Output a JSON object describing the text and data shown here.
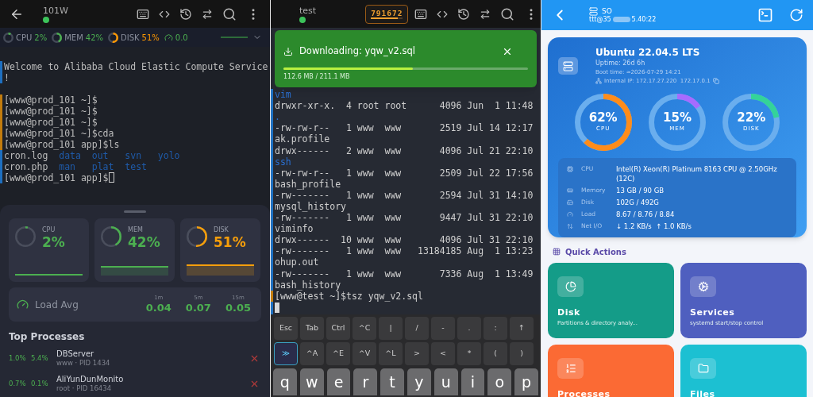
{
  "left": {
    "header": {
      "title": "101W",
      "online": true
    },
    "status_strip": [
      {
        "label": "CPU",
        "value": "2%",
        "level": 0.02,
        "color": "#4caf50"
      },
      {
        "label": "MEM",
        "value": "42%",
        "level": 0.42,
        "color": "#4caf50"
      },
      {
        "label": "DISK",
        "value": "51%",
        "level": 0.51,
        "color": "#ff9800"
      }
    ],
    "status_load": "0.0",
    "terminal": [
      {
        "kind": "text",
        "text": "Welcome to Alibaba Cloud Elastic Compute Service",
        "color": "#1e6fc0"
      },
      {
        "kind": "text",
        "text": "!",
        "color": "#1e6fc0"
      },
      {
        "kind": "blank"
      },
      {
        "kind": "text",
        "text": "[www@prod_101 ~]$",
        "color": "#c27c0e"
      },
      {
        "kind": "text",
        "text": "[www@prod_101 ~]$",
        "color": "#c27c0e"
      },
      {
        "kind": "text",
        "text": "[www@prod_101 ~]$",
        "color": "#c27c0e"
      },
      {
        "kind": "text",
        "text": "[www@prod_101 ~]$cda",
        "color": "#c27c0e"
      },
      {
        "kind": "text",
        "text": "[www@prod_101 app]$ls",
        "color": "#c27c0e"
      },
      {
        "kind": "files",
        "color": "#1e6fc0",
        "items": [
          {
            "text": "cron.log",
            "dir": false
          },
          {
            "text": "data",
            "dir": true
          },
          {
            "text": "out",
            "dir": true
          },
          {
            "text": "svn",
            "dir": true
          },
          {
            "text": "yolo",
            "dir": true
          }
        ]
      },
      {
        "kind": "files",
        "color": "#1e6fc0",
        "items": [
          {
            "text": "cron.php",
            "dir": false
          },
          {
            "text": "man",
            "dir": true
          },
          {
            "text": "plat",
            "dir": true
          },
          {
            "text": "test",
            "dir": true
          }
        ]
      },
      {
        "kind": "text",
        "text": "[www@prod_101 app]$",
        "color": "#1e6fc0",
        "cursor": true
      }
    ],
    "stats": [
      {
        "label": "CPU",
        "value": "2%",
        "level": 0.02,
        "color": "#4caf50"
      },
      {
        "label": "MEM",
        "value": "42%",
        "level": 0.42,
        "color": "#4caf50"
      },
      {
        "label": "DISK",
        "value": "51%",
        "level": 0.51,
        "color": "#f59e0b"
      }
    ],
    "load": {
      "label": "Load Avg",
      "values": [
        {
          "period": "1m",
          "value": "0.04"
        },
        {
          "period": "5m",
          "value": "0.07"
        },
        {
          "period": "15m",
          "value": "0.05"
        }
      ]
    },
    "processes_title": "Top Processes",
    "processes": [
      {
        "cpu": "1.0%",
        "mem": "5.4%",
        "name": "DBServer",
        "detail": "www · PID 1434"
      },
      {
        "cpu": "0.7%",
        "mem": "0.1%",
        "name": "AliYunDunMonito",
        "detail": "root · PID 16434"
      }
    ]
  },
  "middle": {
    "header": {
      "title": "test",
      "online": true
    },
    "badge": {
      "text": "791672",
      "level": 0.85
    },
    "download": {
      "title": "Downloading: yqw_v2.sql",
      "progress": "112.6 MB / 211.1 MB",
      "level": 0.53
    },
    "terminal": [
      {
        "text": "vim",
        "dir": true,
        "color": "#1e6fc0"
      },
      {
        "text": "drwxr-xr-x.  4 root root      4096 Jun  1 11:48",
        "dir": false,
        "color": "#1e6fc0"
      },
      {
        "text": ".",
        "dir": true,
        "color": "#1e6fc0"
      },
      {
        "text": "-rw-rw-r--   1 www  www       2519 Jul 14 12:17",
        "dir": false,
        "color": "#1e6fc0"
      },
      {
        "text": "ak.profile",
        "dir": false,
        "color": "#1e6fc0"
      },
      {
        "text": "drwx------   2 www  www       4096 Jul 21 22:10",
        "dir": false,
        "color": "#1e6fc0"
      },
      {
        "text": "ssh",
        "dir": true,
        "color": "#1e6fc0"
      },
      {
        "text": "-rw-rw-r--   1 www  www       2509 Jul 22 17:56",
        "dir": false,
        "color": "#1e6fc0"
      },
      {
        "text": "bash_profile",
        "dir": false,
        "color": "#1e6fc0"
      },
      {
        "text": "-rw-------   1 www  www       2594 Jul 31 14:10",
        "dir": false,
        "color": "#1e6fc0"
      },
      {
        "text": "mysql_history",
        "dir": false,
        "color": "#1e6fc0"
      },
      {
        "text": "-rw-------   1 www  www       9447 Jul 31 22:10",
        "dir": false,
        "color": "#1e6fc0"
      },
      {
        "text": "viminfo",
        "dir": false,
        "color": "#1e6fc0"
      },
      {
        "text": "drwx------  10 www  www       4096 Jul 31 22:10",
        "dir": false,
        "color": "#1e6fc0"
      },
      {
        "text": "-rw-------   1 www  www   13184185 Aug  1 13:23",
        "dir": false,
        "color": "#1e6fc0"
      },
      {
        "text": "ohup.out",
        "dir": false,
        "color": "#1e6fc0"
      },
      {
        "text": "-rw-------   1 www  www       7336 Aug  1 13:49",
        "dir": false,
        "color": "#1e6fc0"
      },
      {
        "text": "bash_history",
        "dir": false,
        "color": "#1e6fc0"
      },
      {
        "text": "[www@test ~]$tsz yqw_v2.sql",
        "dir": false,
        "color": "#c27c0e"
      }
    ],
    "extra_keys": [
      [
        {
          "label": "Esc",
          "active": false
        },
        {
          "label": "Tab",
          "active": false
        },
        {
          "label": "Ctrl",
          "active": false
        },
        {
          "label": "^C",
          "active": false
        },
        {
          "label": "|",
          "active": false
        },
        {
          "label": "/",
          "active": false
        },
        {
          "label": "-",
          "active": false
        },
        {
          "label": ".",
          "active": false
        },
        {
          "label": ":",
          "active": false
        },
        {
          "label": "↑",
          "active": false
        }
      ],
      [
        {
          "label": "≫",
          "active": true
        },
        {
          "label": "^A",
          "active": false
        },
        {
          "label": "^E",
          "active": false
        },
        {
          "label": "^V",
          "active": false
        },
        {
          "label": "^L",
          "active": false
        },
        {
          "label": ">",
          "active": false
        },
        {
          "label": "<",
          "active": false
        },
        {
          "label": "*",
          "active": false
        },
        {
          "label": "(",
          "active": false
        },
        {
          "label": ")",
          "active": false
        }
      ]
    ],
    "keyboard": [
      "q",
      "w",
      "e",
      "r",
      "t",
      "y",
      "u",
      "i",
      "o",
      "p"
    ]
  },
  "right": {
    "header": {
      "title": "SO",
      "host_start": "ttt@35",
      "host_end": "5.40:22"
    },
    "system": {
      "os": "Ubuntu 22.04.5 LTS",
      "uptime": "Uptime: 26d 6h",
      "boot": "Boot time: ≈2026-07-29 14:21",
      "ip": "Internal IP: 172.17.27.220  172.17.0.1"
    },
    "rings": [
      {
        "value": "62%",
        "label": "CPU",
        "level": 0.62,
        "color": "#ff8c1a"
      },
      {
        "value": "15%",
        "label": "MEM",
        "level": 0.15,
        "color": "#a66bff"
      },
      {
        "value": "22%",
        "label": "DISK",
        "level": 0.22,
        "color": "#34d399"
      }
    ],
    "details": [
      {
        "kind": "cpu",
        "label": "CPU",
        "value": "Intel(R) Xeon(R) Platinum 8163 CPU @ 2.50GHz (12C)"
      },
      {
        "kind": "memory",
        "label": "Memory",
        "value": "13 GB / 90 GB"
      },
      {
        "kind": "disk",
        "label": "Disk",
        "value": "102G / 492G"
      },
      {
        "kind": "load",
        "label": "Load",
        "value": "8.67 / 8.76 / 8.84"
      },
      {
        "kind": "net",
        "label": "Net I/O",
        "value": "↓ 1.2 KB/s  ↑ 1.0 KB/s"
      }
    ],
    "quick_title": "Quick Actions",
    "actions": [
      {
        "kind": "disk",
        "title": "Disk",
        "subtitle": "Partitions & directory analy...",
        "color": "#149c88"
      },
      {
        "kind": "services",
        "title": "Services",
        "subtitle": "systemd start/stop control",
        "color": "#4f5fbf"
      },
      {
        "kind": "processes",
        "title": "Processes",
        "color": "#fb6a34"
      },
      {
        "kind": "files",
        "title": "Files",
        "color": "#1cc0d2"
      }
    ]
  }
}
